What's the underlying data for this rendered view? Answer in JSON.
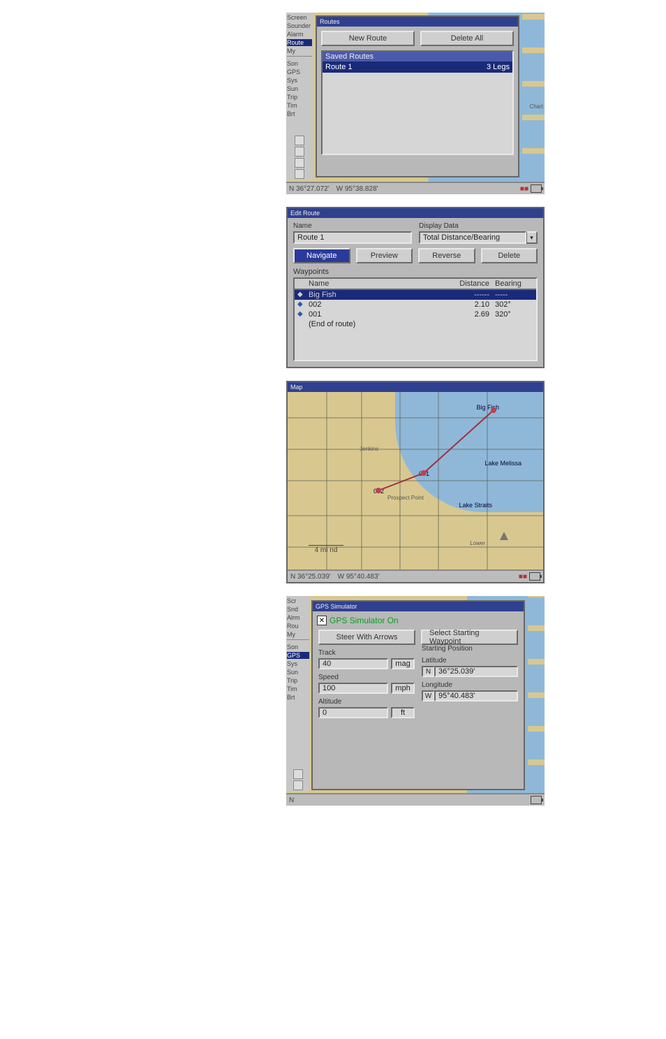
{
  "panel1": {
    "title": "Routes",
    "menu": [
      "Screen",
      "Sounder",
      "Alarm",
      "Route",
      "My",
      "",
      "Son",
      "GPS",
      "Sys",
      "Sun",
      "Trip",
      "Tim",
      "Brt"
    ],
    "buttons": {
      "new": "New Route",
      "deleteAll": "Delete All"
    },
    "listHeader": "Saved Routes",
    "route": {
      "name": "Route 1",
      "legs": "3 Legs"
    },
    "status": {
      "lat": "N   36°27.072'",
      "lon": "W   95°38.828'",
      "sat": "■■",
      "bat": ""
    },
    "depthLabel": "Chart"
  },
  "panel2": {
    "title": "Edit Route",
    "nameLabel": "Name",
    "nameValue": "Route 1",
    "displayLabel": "Display Data",
    "displayValue": "Total Distance/Bearing",
    "buttons": {
      "navigate": "Navigate",
      "preview": "Preview",
      "reverse": "Reverse",
      "delete": "Delete"
    },
    "waypointsHeader": "Waypoints",
    "cols": {
      "name": "Name",
      "distance": "Distance",
      "bearing": "Bearing"
    },
    "rows": [
      {
        "ico": "◆",
        "name": "Big Fish",
        "distance": "------",
        "bearing": "-----",
        "sel": true
      },
      {
        "ico": "◆",
        "name": "002",
        "distance": "2.10",
        "bearing": "302°",
        "sel": false
      },
      {
        "ico": "◆",
        "name": "001",
        "distance": "2.69",
        "bearing": "320°",
        "sel": false
      },
      {
        "ico": "",
        "name": "(End of route)",
        "distance": "",
        "bearing": "",
        "sel": false
      }
    ]
  },
  "panel3": {
    "title": "Map",
    "labels": {
      "bigfish": "Big Fish",
      "w001": "001",
      "w002": "002",
      "lakeMelissa": "Lake Melissa",
      "lakeStraits": "Lake Straits",
      "jenkins": "Jenkins",
      "prospect": "Prospect Point",
      "lower": "Lower"
    },
    "scale": "4 mi nd",
    "status": {
      "lat": "N   36°25.039'",
      "lon": "W   95°40.483'",
      "sat": "■■"
    }
  },
  "panel4": {
    "title": "GPS Simulator",
    "menu": [
      "Scr",
      "Snd",
      "Alrm",
      "Rou",
      "My",
      "",
      "Son",
      "GPS",
      "Sys",
      "Sun",
      "Trip",
      "Tim",
      "Brt"
    ],
    "gpsOn": "GPS Simulator On",
    "steer": "Steer With Arrows",
    "selectWp": "Select Starting Waypoint",
    "startingPos": "Starting Position",
    "track": {
      "label": "Track",
      "value": "40",
      "unit": "mag"
    },
    "speed": {
      "label": "Speed",
      "value": "100",
      "unit": "mph"
    },
    "altitude": {
      "label": "Altitude",
      "value": "0",
      "unit": "ft"
    },
    "lat": {
      "label": "Latitude",
      "dir": "N",
      "value": "36°25.039'"
    },
    "lon": {
      "label": "Longitude",
      "dir": "W",
      "value": "95°40.483'"
    },
    "status": {
      "lat": "N",
      "sat": ""
    }
  }
}
